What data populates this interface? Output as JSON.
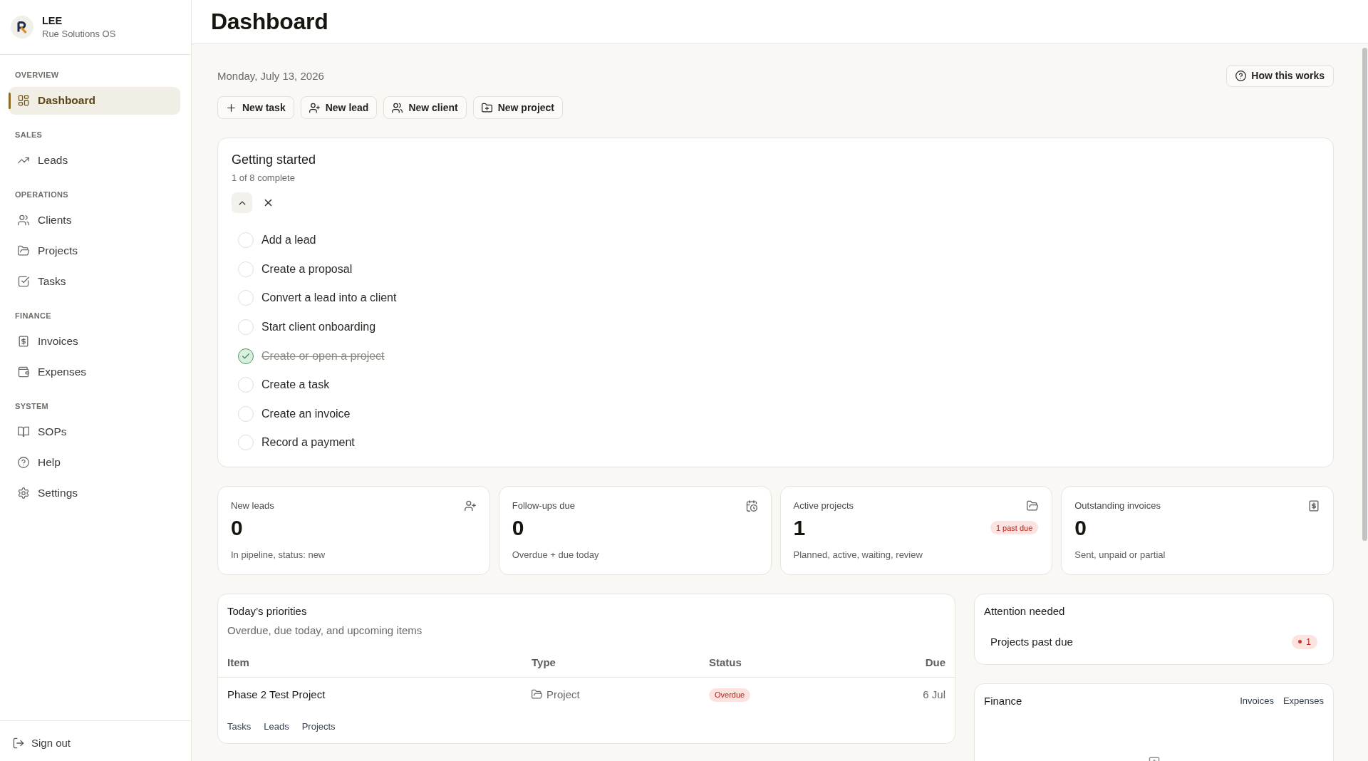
{
  "sidebar": {
    "brand": {
      "name": "LEE",
      "subtitle": "Rue Solutions OS"
    },
    "sections": [
      {
        "label": "OVERVIEW",
        "items": [
          {
            "label": "Dashboard",
            "selected": true
          }
        ]
      },
      {
        "label": "SALES",
        "items": [
          {
            "label": "Leads",
            "selected": false
          }
        ]
      },
      {
        "label": "OPERATIONS",
        "items": [
          {
            "label": "Clients",
            "selected": false
          },
          {
            "label": "Projects",
            "selected": false
          },
          {
            "label": "Tasks",
            "selected": false
          }
        ]
      },
      {
        "label": "FINANCE",
        "items": [
          {
            "label": "Invoices",
            "selected": false
          },
          {
            "label": "Expenses",
            "selected": false
          }
        ]
      },
      {
        "label": "SYSTEM",
        "items": [
          {
            "label": "SOPs",
            "selected": false
          },
          {
            "label": "Help",
            "selected": false
          },
          {
            "label": "Settings",
            "selected": false
          }
        ]
      }
    ],
    "sign_out": "Sign out"
  },
  "header": {
    "title": "Dashboard"
  },
  "date": "Monday, July 13, 2026",
  "help_button": {
    "label": "How this works"
  },
  "quick_actions": [
    {
      "label": "New task"
    },
    {
      "label": "New lead"
    },
    {
      "label": "New client"
    },
    {
      "label": "New project"
    }
  ],
  "getting_started": {
    "title": "Getting started",
    "progress": "1 of 8 complete",
    "expanded": true,
    "steps": [
      {
        "label": "Add a lead",
        "checked": false
      },
      {
        "label": "Create a proposal",
        "checked": false
      },
      {
        "label": "Convert a lead into a client",
        "checked": false
      },
      {
        "label": "Start client onboarding",
        "checked": false
      },
      {
        "label": "Create or open a project",
        "checked": true
      },
      {
        "label": "Create a task",
        "checked": false
      },
      {
        "label": "Create an invoice",
        "checked": false
      },
      {
        "label": "Record a payment",
        "checked": false
      }
    ]
  },
  "stats": [
    {
      "label": "New leads",
      "value": "0",
      "note": "In pipeline, status: new"
    },
    {
      "label": "Follow-ups due",
      "value": "0",
      "note": "Overdue + due today"
    },
    {
      "label": "Active projects",
      "value": "1",
      "badge": "1 past due",
      "note": "Planned, active, waiting, review"
    },
    {
      "label": "Outstanding invoices",
      "value": "0",
      "note": "Sent, unpaid or partial"
    }
  ],
  "priorities": {
    "title": "Today’s priorities",
    "subtitle": "Overdue, due today, and upcoming items",
    "columns": [
      "Item",
      "Type",
      "Status",
      "Due"
    ],
    "rows": [
      {
        "item": "Phase 2 Test Project",
        "type": "Project",
        "status": "Overdue",
        "due": "6 Jul"
      }
    ],
    "links": [
      "Tasks",
      "Leads",
      "Projects"
    ]
  },
  "attention": {
    "title": "Attention needed",
    "items": [
      {
        "label": "Projects past due",
        "count": "1"
      }
    ]
  },
  "finance": {
    "title": "Finance",
    "links": [
      "Invoices",
      "Expenses"
    ]
  }
}
